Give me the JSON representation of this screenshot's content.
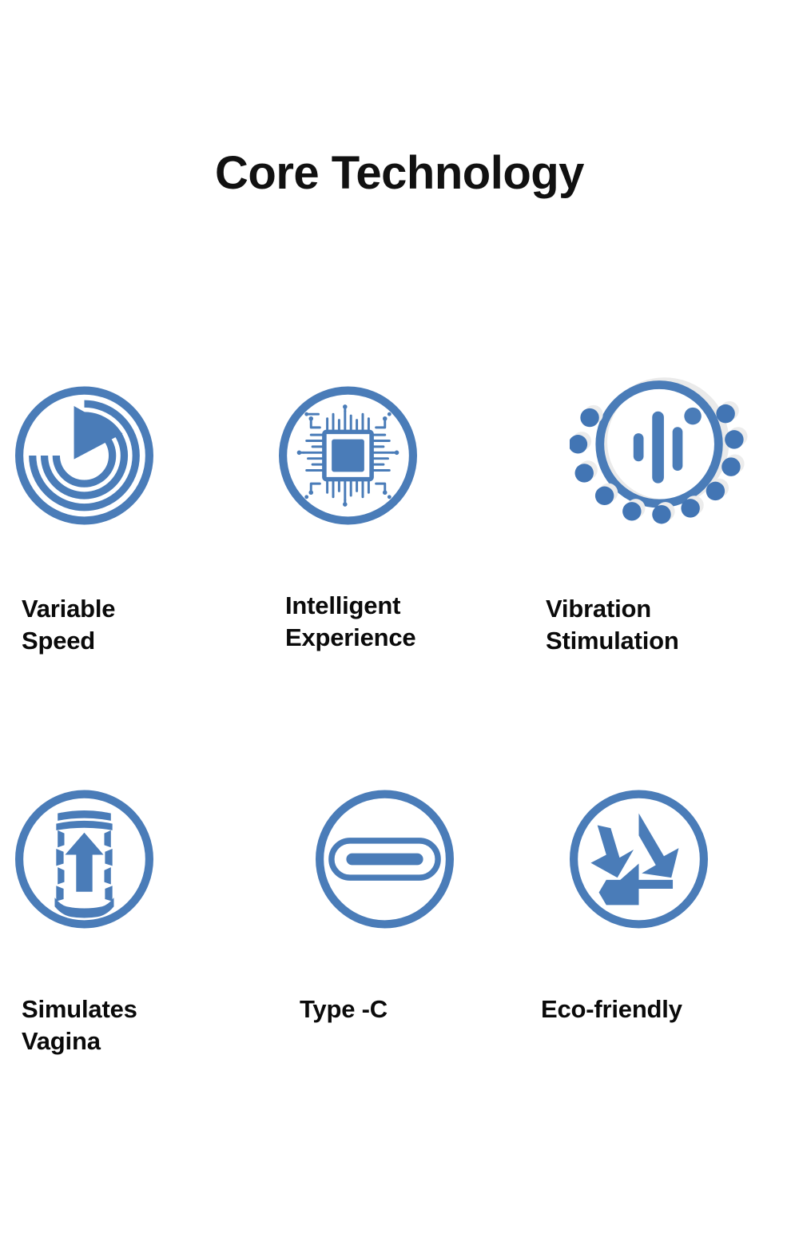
{
  "page": {
    "title": "Core Technology",
    "background_color": "#ffffff",
    "accent_color": "#4a7cb8",
    "text_color": "#0a0a0a"
  },
  "features": [
    {
      "icon": "variable-speed-icon",
      "label": "Variable\nSpeed",
      "row": 0,
      "column": 0
    },
    {
      "icon": "microchip-icon",
      "label": "Intelligent\nExperience",
      "row": 0,
      "column": 1
    },
    {
      "icon": "vibration-waveform-icon",
      "label": "Vibration\nStimulation",
      "row": 0,
      "column": 2
    },
    {
      "icon": "sleeve-arrow-icon",
      "label": "Simulates\nVagina",
      "row": 1,
      "column": 0
    },
    {
      "icon": "usb-type-c-icon",
      "label": "Type -C",
      "row": 1,
      "column": 1
    },
    {
      "icon": "recycle-icon",
      "label": "Eco-friendly",
      "row": 1,
      "column": 2
    }
  ]
}
